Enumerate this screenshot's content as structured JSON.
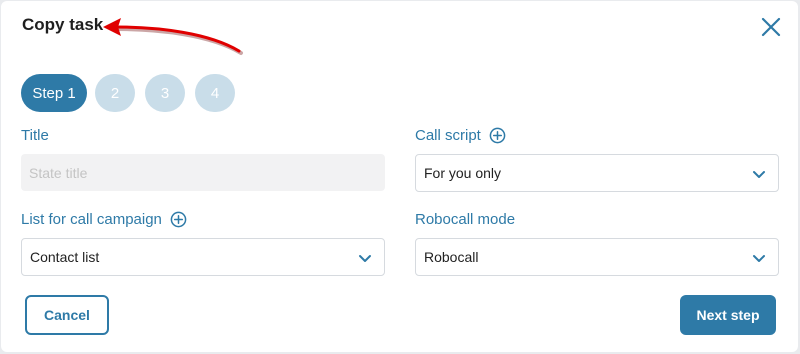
{
  "dialog": {
    "title": "Copy task"
  },
  "steps": [
    {
      "label": "Step 1",
      "state": "active"
    },
    {
      "label": "2",
      "state": "inactive"
    },
    {
      "label": "3",
      "state": "inactive"
    },
    {
      "label": "4",
      "state": "inactive"
    }
  ],
  "fields": {
    "title": {
      "label": "Title",
      "placeholder": "State title",
      "value": ""
    },
    "call_script": {
      "label": "Call script",
      "value": "For you only"
    },
    "list": {
      "label": "List for call campaign",
      "value": "Contact list"
    },
    "robocall_mode": {
      "label": "Robocall mode",
      "value": "Robocall"
    }
  },
  "buttons": {
    "cancel": "Cancel",
    "next": "Next step"
  },
  "icons": {
    "close": "close-icon",
    "plus": "plus-circle-icon",
    "chevron": "chevron-down-icon",
    "arrow": "red-arrow-annotation"
  },
  "colors": {
    "accent": "#2e7aa7",
    "step_inactive": "#c9dde9",
    "annotation": "#e00000"
  }
}
